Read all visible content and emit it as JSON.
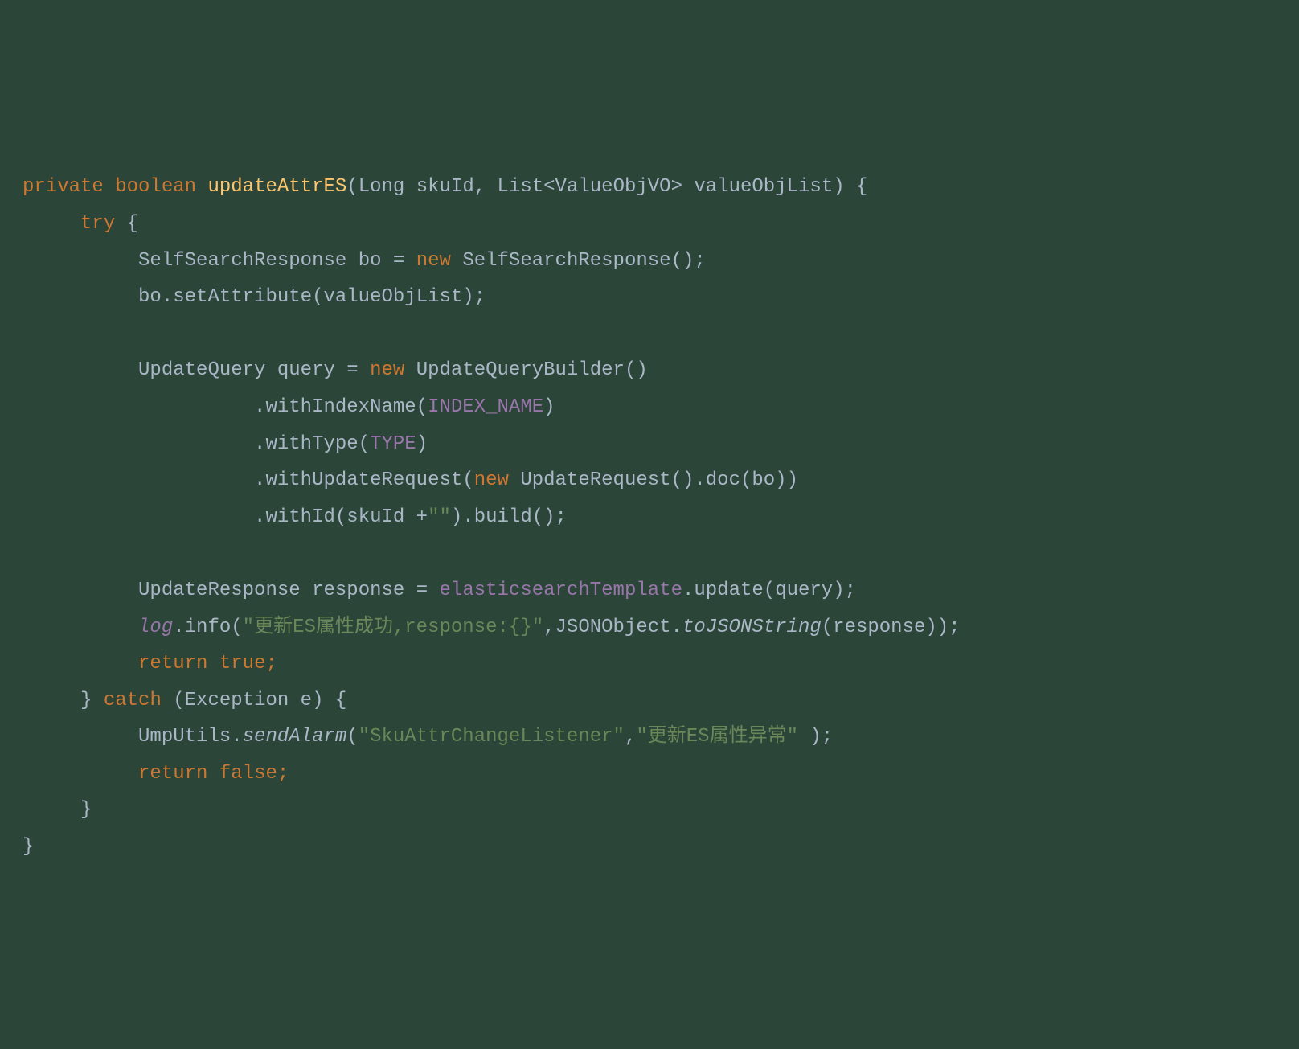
{
  "code": {
    "l1": {
      "kw_private": "private",
      "kw_boolean": "boolean",
      "fn_name": "updateAttrES",
      "open_paren": "(",
      "param1_type": "Long ",
      "param1_name": "skuId",
      "comma1": ", ",
      "param2_type": "List<ValueObjVO> ",
      "param2_name": "valueObjList",
      "close_paren": ")",
      "open_brace": " {"
    },
    "l2": {
      "kw_try": "try",
      "open_brace": " {"
    },
    "l3": {
      "type1": "SelfSearchResponse ",
      "var1": "bo = ",
      "kw_new": "new",
      "ctor": " SelfSearchResponse()",
      "semi": ";"
    },
    "l4": {
      "stmt": "bo.setAttribute(valueObjList);"
    },
    "l5": {
      "type1": "UpdateQuery ",
      "var1": "query = ",
      "kw_new": "new",
      "ctor": " UpdateQueryBuilder()"
    },
    "l6": {
      "pre": ".withIndexName(",
      "const1": "INDEX_NAME",
      "post": ")"
    },
    "l7": {
      "pre": ".withType(",
      "const1": "TYPE",
      "post": ")"
    },
    "l8": {
      "pre": ".withUpdateRequest(",
      "kw_new": "new",
      "ctor": " UpdateRequest().doc(bo))"
    },
    "l9": {
      "pre": ".withId(skuId +",
      "str": "\"\"",
      "post": ").build();"
    },
    "l10": {
      "type1": "UpdateResponse ",
      "var1": "response = ",
      "field1": "elasticsearchTemplate",
      "post": ".update(query);"
    },
    "l11": {
      "log": "log",
      "method": ".info(",
      "str1": "\"更新ES属性成功,response:{}\"",
      "mid": ",JSONObject.",
      "ital": "toJSONString",
      "post": "(response));"
    },
    "l12": {
      "kw_return": "return",
      "val": " true;"
    },
    "l13": {
      "close": "} ",
      "kw_catch": "catch",
      "args": " (Exception e) {"
    },
    "l14": {
      "pre": "UmpUtils.",
      "ital": "sendAlarm",
      "open": "(",
      "str1": "\"SkuAttrChangeListener\"",
      "comma": ",",
      "str2": "\"更新ES属性异常\" ",
      "post": ");"
    },
    "l15": {
      "kw_return": "return",
      "val": " false;"
    },
    "l16": {
      "close": "}"
    },
    "l17": {
      "close": "}"
    }
  }
}
